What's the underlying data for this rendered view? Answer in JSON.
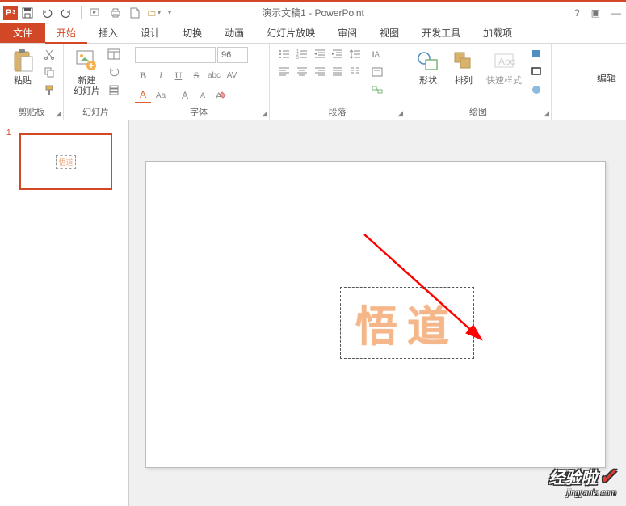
{
  "title": "演示文稿1 - PowerPoint",
  "app_letter": "P",
  "qat": {
    "dropdown": "▾"
  },
  "tabs": {
    "file": "文件",
    "home": "开始",
    "insert": "插入",
    "design": "设计",
    "transitions": "切换",
    "animations": "动画",
    "slideshow": "幻灯片放映",
    "review": "审阅",
    "view": "视图",
    "developer": "开发工具",
    "addins": "加载项"
  },
  "groups": {
    "clipboard": {
      "label": "剪贴板",
      "paste": "粘贴"
    },
    "slides": {
      "label": "幻灯片",
      "newslide": "新建\n幻灯片"
    },
    "font": {
      "label": "字体",
      "size": "96"
    },
    "paragraph": {
      "label": "段落"
    },
    "drawing": {
      "label": "绘图",
      "shapes": "形状",
      "arrange": "排列",
      "quick": "快速样式"
    },
    "editing": {
      "label": "编辑"
    }
  },
  "font_buttons": {
    "B": "B",
    "I": "I",
    "U": "U",
    "S": "S",
    "abc": "abc",
    "AV": "AV",
    "Aa": "Aa",
    "A": "A",
    "Ap": "A",
    "Am": "A"
  },
  "thumb": {
    "num": "1",
    "text": "悟道"
  },
  "slide_text": "悟道",
  "watermark": {
    "main": "经验啦",
    "check": "✓",
    "sub": "jingyanla.com"
  },
  "winbtn": {
    "help": "?",
    "ropt": "▣",
    "min": "—"
  }
}
